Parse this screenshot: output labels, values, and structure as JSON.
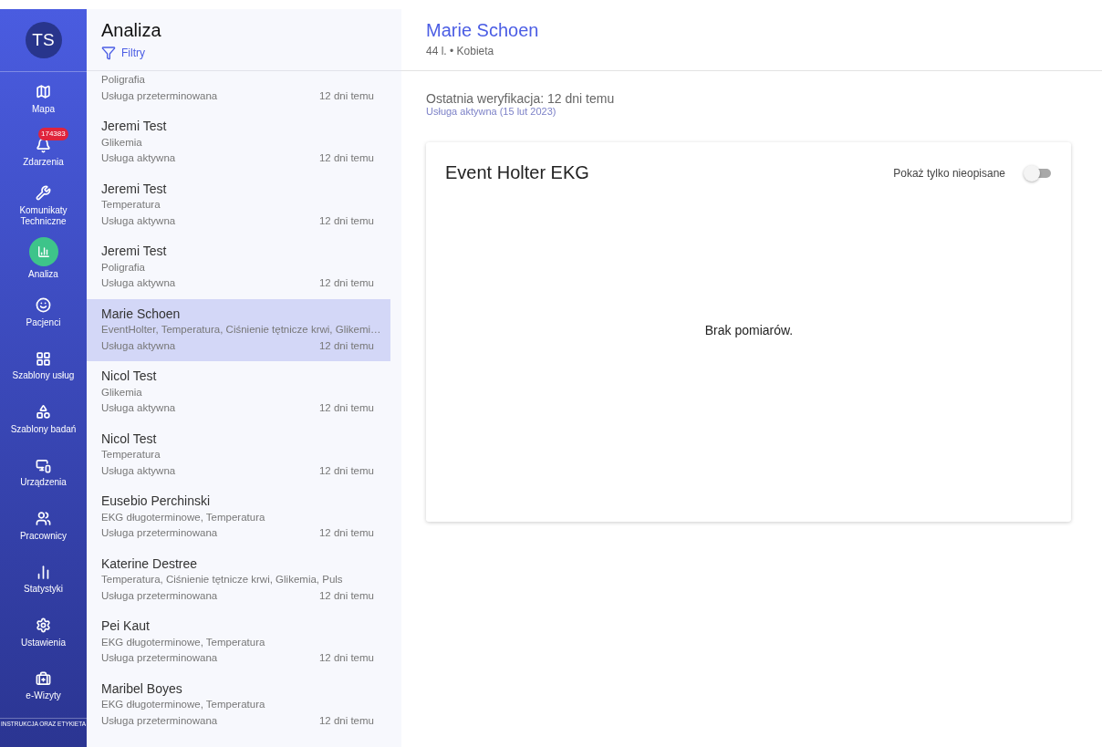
{
  "sidebar": {
    "avatar": "TS",
    "items": [
      {
        "kind": "map",
        "label": "Mapa",
        "selected": false
      },
      {
        "kind": "bell",
        "label": "Zdarzenia",
        "selected": false,
        "badge": "174383"
      },
      {
        "kind": "wrench",
        "label": "Komunikaty Techniczne",
        "selected": false
      },
      {
        "kind": "chart",
        "label": "Analiza",
        "selected": true
      },
      {
        "kind": "face",
        "label": "Pacjenci",
        "selected": false
      },
      {
        "kind": "grid",
        "label": "Szablony usług",
        "selected": false
      },
      {
        "kind": "shapes",
        "label": "Szablony badań",
        "selected": false
      },
      {
        "kind": "devices",
        "label": "Urządzenia",
        "selected": false
      },
      {
        "kind": "people",
        "label": "Pracownicy",
        "selected": false
      },
      {
        "kind": "stats",
        "label": "Statystyki",
        "selected": false
      },
      {
        "kind": "gear",
        "label": "Ustawienia",
        "selected": false
      },
      {
        "kind": "medkit",
        "label": "e-Wizyty",
        "selected": false
      }
    ],
    "footer": "INSTRUKCJA ORAZ ETYKIETA"
  },
  "list": {
    "title": "Analiza",
    "filter": "Filtry",
    "rows": [
      {
        "services": "Poligrafia",
        "status": "Usługa przeterminowana",
        "time": "12 dni temu",
        "selected": false
      },
      {
        "name": "Jeremi Test",
        "services": "Glikemia",
        "status": "Usługa aktywna",
        "time": "12 dni temu",
        "selected": false
      },
      {
        "name": "Jeremi Test",
        "services": "Temperatura",
        "status": "Usługa aktywna",
        "time": "12 dni temu",
        "selected": false
      },
      {
        "name": "Jeremi Test",
        "services": "Poligrafia",
        "status": "Usługa aktywna",
        "time": "12 dni temu",
        "selected": false
      },
      {
        "name": "Marie Schoen",
        "services": "EventHolter, Temperatura, Ciśnienie tętnicze krwi, Glikemi…",
        "status": "Usługa aktywna",
        "time": "12 dni temu",
        "selected": true
      },
      {
        "name": "Nicol Test",
        "services": "Glikemia",
        "status": "Usługa aktywna",
        "time": "12 dni temu",
        "selected": false
      },
      {
        "name": "Nicol Test",
        "services": "Temperatura",
        "status": "Usługa aktywna",
        "time": "12 dni temu",
        "selected": false
      },
      {
        "name": "Eusebio Perchinski",
        "services": "EKG długoterminowe, Temperatura",
        "status": "Usługa przeterminowana",
        "time": "12 dni temu",
        "selected": false
      },
      {
        "name": "Katerine Destree",
        "services": "Temperatura, Ciśnienie tętnicze krwi, Glikemia, Puls",
        "status": "Usługa przeterminowana",
        "time": "12 dni temu",
        "selected": false
      },
      {
        "name": "Pei Kaut",
        "services": "EKG długoterminowe, Temperatura",
        "status": "Usługa przeterminowana",
        "time": "12 dni temu",
        "selected": false
      },
      {
        "name": "Maribel Boyes",
        "services": "EKG długoterminowe, Temperatura",
        "status": "Usługa przeterminowana",
        "time": "12 dni temu",
        "selected": false
      }
    ]
  },
  "patient": {
    "name": "Marie Schoen",
    "details": "44 l. • Kobieta",
    "verification": "Ostatnia weryfikacja: 12 dni temu",
    "service": "Usługa aktywna (15 lut 2023)"
  },
  "card": {
    "title": "Event Holter EKG",
    "toggle": {
      "label": "Pokaż tylko nieopisane",
      "on": false
    },
    "empty": "Brak pomiarów."
  }
}
